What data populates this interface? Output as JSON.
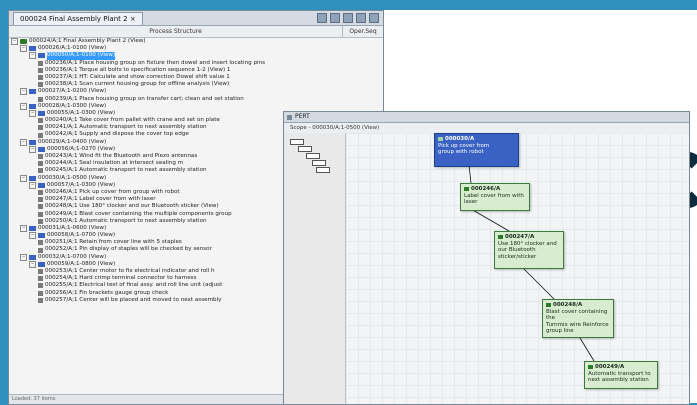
{
  "window": {
    "tab_title": "000024 Final Assembly Plant 2",
    "column_process_structure": "Process Structure",
    "column_ops": "Oper.Seq"
  },
  "tree": {
    "rows": [
      {
        "indent": 0,
        "icon": "op",
        "text": "000024/A;1 Final Assembly Plant 2 (View)"
      },
      {
        "indent": 1,
        "icon": "pl",
        "text": "000026/A;1-0100 (View)"
      },
      {
        "indent": 2,
        "icon": "pl",
        "text": "000050/A;1-0100 (View)",
        "selected": true
      },
      {
        "indent": 3,
        "icon": "act",
        "text": "000236/A;1 Place housing group on fixture then dowel and insert locating pins"
      },
      {
        "indent": 3,
        "icon": "act",
        "text": "000236/A;1 Torque all bolts to specification sequence 1-2 (View) 1"
      },
      {
        "indent": 3,
        "icon": "act",
        "text": "000237/A;1 HT: Calculate and show correction Dowel shift value 1"
      },
      {
        "indent": 3,
        "icon": "act",
        "text": "000238/A;1 Scan current housing group for offline analysis (View)"
      },
      {
        "indent": 1,
        "icon": "pl",
        "text": "000027/A;1-0200 (View)"
      },
      {
        "indent": 3,
        "icon": "act",
        "text": "000239/A;1 Place housing group on transfer cart; clean and set station"
      },
      {
        "indent": 1,
        "icon": "pl",
        "text": "000028/A;1-0300 (View)"
      },
      {
        "indent": 2,
        "icon": "pl",
        "text": "000055/A;1-0300 (View)"
      },
      {
        "indent": 3,
        "icon": "act",
        "text": "000240/A;1 Take cover from pallet with crane and set on plate"
      },
      {
        "indent": 3,
        "icon": "act",
        "text": "000241/A;1 Automatic transport to next assembly station"
      },
      {
        "indent": 3,
        "icon": "act",
        "text": "000242/A;1 Supply and dispose the cover top edge"
      },
      {
        "indent": 1,
        "icon": "pl",
        "text": "000029/A;1-0400 (View)"
      },
      {
        "indent": 2,
        "icon": "pl",
        "text": "000056/A;1-0270 (View)"
      },
      {
        "indent": 3,
        "icon": "act",
        "text": "000243/A;1 Wind fit the Bluetooth and Piezo antennas"
      },
      {
        "indent": 3,
        "icon": "act",
        "text": "000244/A;1 Seal insulation at intersect sealing m"
      },
      {
        "indent": 3,
        "icon": "act",
        "text": "000245/A;1 Automatic transport to next assembly station"
      },
      {
        "indent": 1,
        "icon": "pl",
        "text": "000030/A;1-0500 (View)"
      },
      {
        "indent": 2,
        "icon": "pl",
        "text": "000057/A;1-0300 (View)"
      },
      {
        "indent": 3,
        "icon": "act",
        "text": "000246/A;1 Pick up cover from group with robot"
      },
      {
        "indent": 3,
        "icon": "act",
        "text": "000247/A;1 Label cover from with laser"
      },
      {
        "indent": 3,
        "icon": "act",
        "text": "000248/A;1 Use 180° clocker and our Bluetooth sticker (View)"
      },
      {
        "indent": 3,
        "icon": "act",
        "text": "000249/A;1 Blast cover containing the multiple components group"
      },
      {
        "indent": 3,
        "icon": "act",
        "text": "000250/A;1 Automatic transport to next assembly station"
      },
      {
        "indent": 1,
        "icon": "pl",
        "text": "000031/A;1-0600 (View)"
      },
      {
        "indent": 2,
        "icon": "pl",
        "text": "000058/A;1-0700 (View)"
      },
      {
        "indent": 3,
        "icon": "act",
        "text": "000251/A;1 Retain from cover line with 5 staples"
      },
      {
        "indent": 3,
        "icon": "act",
        "text": "000252/A;1 Pin display of staples will be checked by sensor"
      },
      {
        "indent": 1,
        "icon": "pl",
        "text": "000032/A;1-0700 (View)"
      },
      {
        "indent": 2,
        "icon": "pl",
        "text": "000059/A;1-0800 (View)"
      },
      {
        "indent": 3,
        "icon": "act",
        "text": "000253/A;1 Center motor to fix electrical indicator and roll h"
      },
      {
        "indent": 3,
        "icon": "act",
        "text": "000254/A;1 Hard crimp terminal connector to harness"
      },
      {
        "indent": 3,
        "icon": "act",
        "text": "000255/A;1 Electrical test of final assy. and roll line unit (adjust"
      },
      {
        "indent": 3,
        "icon": "act",
        "text": "000256/A;1 Fin brackets gauge group check"
      },
      {
        "indent": 3,
        "icon": "act",
        "text": "000257/A;1 Center will be placed and moved to next assembly"
      }
    ],
    "status": "Loaded: 37 items"
  },
  "pert": {
    "title": "PERT",
    "scope": "Scope - 000030/A;1-0500 (View)",
    "nodes": [
      {
        "id": "000030/A",
        "lines": [
          "Pick up cover from",
          "group with robot"
        ],
        "blue": true
      },
      {
        "id": "000246/A",
        "lines": [
          "Label cover from with",
          "laser"
        ]
      },
      {
        "id": "000247/A",
        "lines": [
          "Use 180° clocker and",
          "our Bluetooth",
          "sticker/sticker"
        ]
      },
      {
        "id": "000248/A",
        "lines": [
          "Blast cover containing the",
          "Turnmix wire Reinforce",
          "group line"
        ]
      },
      {
        "id": "000249/A",
        "lines": [
          "Automatic transport to",
          "next assembly station"
        ]
      }
    ]
  },
  "colors": {
    "frame": "#2f8fbd",
    "selection": "#3399ff",
    "node_fill": "#d8ecd0",
    "node_blue": "#3a62c4"
  }
}
